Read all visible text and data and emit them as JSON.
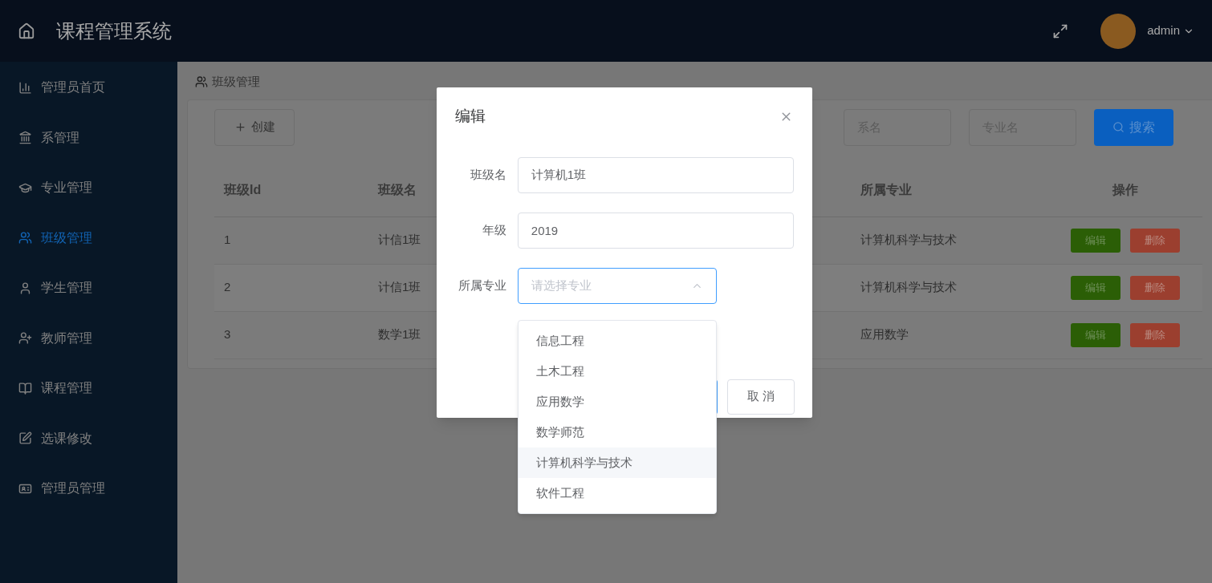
{
  "header": {
    "title": "课程管理系统",
    "user": "admin"
  },
  "sidebar": {
    "items": [
      {
        "label": "管理员首页",
        "selected": false
      },
      {
        "label": "系管理",
        "selected": false
      },
      {
        "label": "专业管理",
        "selected": false
      },
      {
        "label": "班级管理",
        "selected": true
      },
      {
        "label": "学生管理",
        "selected": false
      },
      {
        "label": "教师管理",
        "selected": false
      },
      {
        "label": "课程管理",
        "selected": false
      },
      {
        "label": "选课修改",
        "selected": false
      },
      {
        "label": "管理员管理",
        "selected": false
      }
    ]
  },
  "breadcrumb": "班级管理",
  "toolbar": {
    "create_button": "创建",
    "search_fields": [
      {
        "placeholder": "系名"
      },
      {
        "placeholder": "专业名"
      }
    ],
    "search_button": "搜索"
  },
  "table": {
    "columns": [
      "班级Id",
      "班级名",
      "所属专业",
      "操作"
    ],
    "rows": [
      {
        "id": "1",
        "name": "计信1班",
        "major": "计算机科学与技术",
        "edit": "编辑",
        "delete": "删除"
      },
      {
        "id": "2",
        "name": "计信1班",
        "major": "计算机科学与技术",
        "edit": "编辑",
        "delete": "删除"
      },
      {
        "id": "3",
        "name": "数学1班",
        "major": "应用数学",
        "edit": "编辑",
        "delete": "删除"
      }
    ]
  },
  "dialog": {
    "title": "编辑",
    "fields": [
      {
        "label": "班级名",
        "value": "计算机1班"
      },
      {
        "label": "年级",
        "value": "2019"
      }
    ],
    "select": {
      "label": "所属专业",
      "placeholder": "请选择专业",
      "expanded": true
    },
    "cancel_button": "取 消",
    "options": [
      {
        "label": "信息工程",
        "hovered": false
      },
      {
        "label": "土木工程",
        "hovered": false
      },
      {
        "label": "应用数学",
        "hovered": false
      },
      {
        "label": "数学师范",
        "hovered": false
      },
      {
        "label": "计算机科学与技术",
        "hovered": true
      },
      {
        "label": "软件工程",
        "hovered": false
      }
    ]
  }
}
